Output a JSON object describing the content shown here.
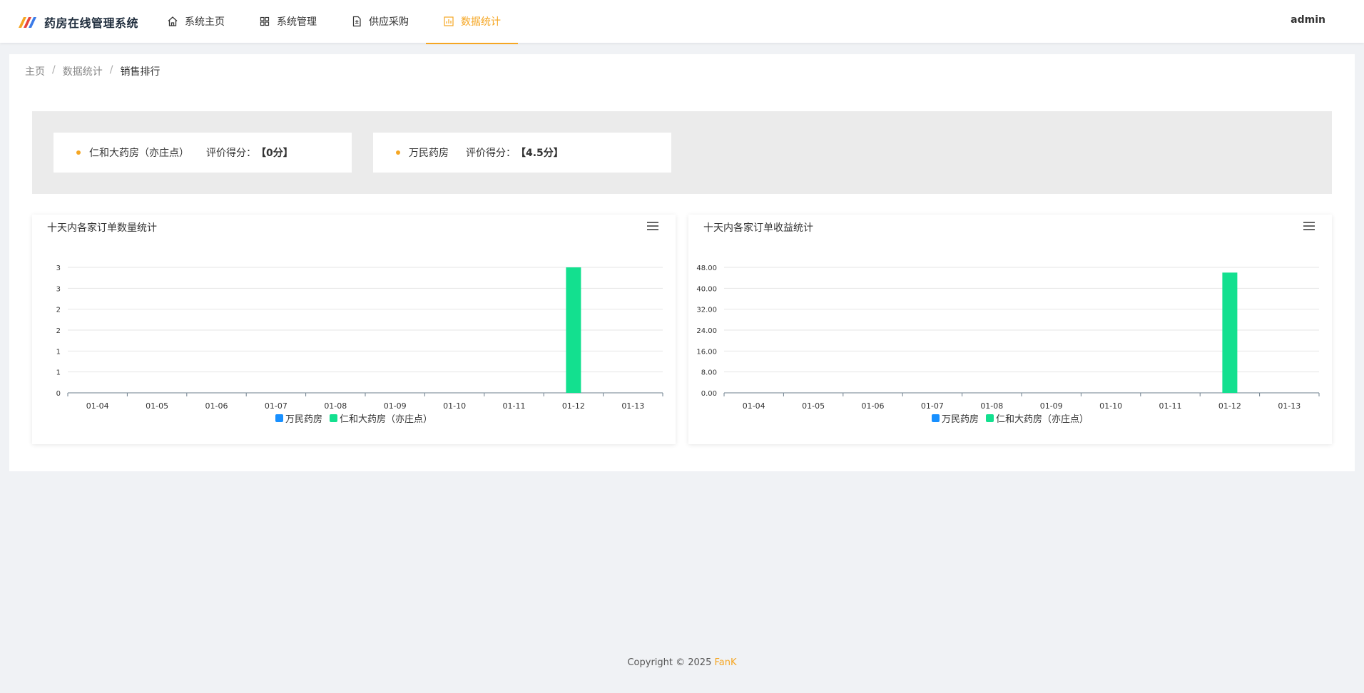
{
  "app": {
    "title": "药房在线管理系统",
    "user": "admin"
  },
  "nav": [
    {
      "label": "系统主页",
      "icon": "home-icon"
    },
    {
      "label": "系统管理",
      "icon": "grid-icon"
    },
    {
      "label": "供应采购",
      "icon": "document-icon"
    },
    {
      "label": "数据统计",
      "icon": "chart-icon",
      "active": true
    }
  ],
  "breadcrumb": [
    "主页",
    "数据统计",
    "销售排行"
  ],
  "ranking": [
    {
      "name": "仁和大药房（亦庄点）",
      "score_label": "评价得分：",
      "score": "【0分】"
    },
    {
      "name": "万民药房",
      "score_label": "评价得分：",
      "score": "【4.5分】"
    }
  ],
  "colors": {
    "accent": "#f5a623",
    "series_blue": "#1890ff",
    "series_green": "#13e08f"
  },
  "chart_data": [
    {
      "type": "bar",
      "title": "十天内各家订单数量统计",
      "categories": [
        "01-04",
        "01-05",
        "01-06",
        "01-07",
        "01-08",
        "01-09",
        "01-10",
        "01-11",
        "01-12",
        "01-13"
      ],
      "y_tick_labels": [
        "0",
        "1",
        "1",
        "2",
        "2",
        "3",
        "3"
      ],
      "ylim": [
        0,
        3
      ],
      "series": [
        {
          "name": "万民药房",
          "color": "#1890ff",
          "values": [
            0,
            0,
            0,
            0,
            0,
            0,
            0,
            0,
            0,
            0
          ]
        },
        {
          "name": "仁和大药房（亦庄点）",
          "color": "#13e08f",
          "values": [
            0,
            0,
            0,
            0,
            0,
            0,
            0,
            0,
            3,
            0
          ]
        }
      ],
      "grid": true,
      "legend": "bottom"
    },
    {
      "type": "bar",
      "title": "十天内各家订单收益统计",
      "categories": [
        "01-04",
        "01-05",
        "01-06",
        "01-07",
        "01-08",
        "01-09",
        "01-10",
        "01-11",
        "01-12",
        "01-13"
      ],
      "y_tick_labels": [
        "0.00",
        "8.00",
        "16.00",
        "24.00",
        "32.00",
        "40.00",
        "48.00"
      ],
      "ylim": [
        0,
        48
      ],
      "series": [
        {
          "name": "万民药房",
          "color": "#1890ff",
          "values": [
            0,
            0,
            0,
            0,
            0,
            0,
            0,
            0,
            0,
            0
          ]
        },
        {
          "name": "仁和大药房（亦庄点）",
          "color": "#13e08f",
          "values": [
            0,
            0,
            0,
            0,
            0,
            0,
            0,
            0,
            46,
            0
          ]
        }
      ],
      "grid": true,
      "legend": "bottom"
    }
  ],
  "footer": {
    "copyright": "Copyright © 2025 ",
    "author": "FanK"
  }
}
